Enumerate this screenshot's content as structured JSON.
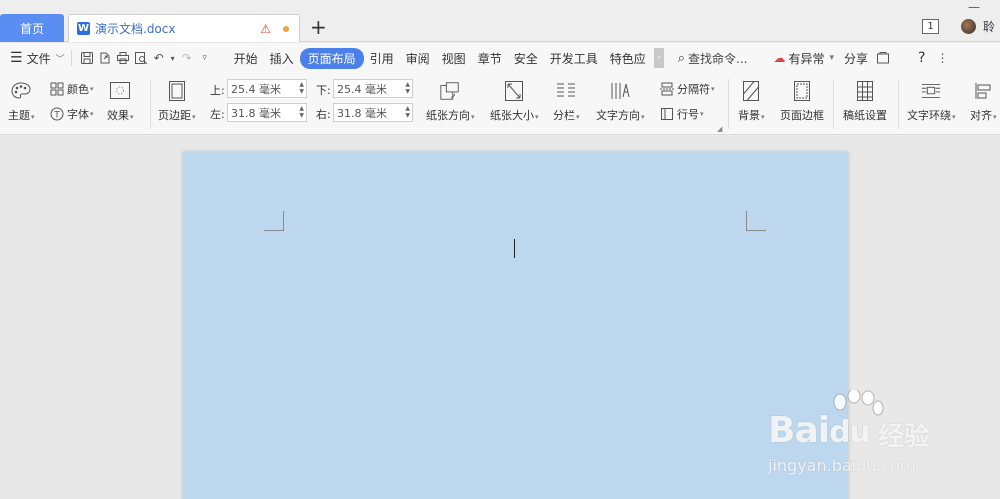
{
  "tabs": {
    "home": "首页",
    "doc_title": "演示文档.docx",
    "new_tab": "+"
  },
  "window": {
    "minimize": "—",
    "page_badge": "1",
    "user_name": "聆"
  },
  "menu": {
    "file": "文件",
    "tabs": [
      "开始",
      "插入",
      "页面布局",
      "引用",
      "审阅",
      "视图",
      "章节",
      "安全",
      "开发工具",
      "特色应"
    ],
    "active_tab": "页面布局",
    "search": "查找命令...",
    "anomaly": "有异常",
    "share": "分享",
    "help": "?"
  },
  "ribbon": {
    "theme": "主题",
    "color": "颜色",
    "font": "字体",
    "effect": "效果",
    "margins": "页边距",
    "top_label": "上:",
    "bottom_label": "下:",
    "left_label": "左:",
    "right_label": "右:",
    "top_value": "25.4 毫米",
    "bottom_value": "25.4 毫米",
    "left_value": "31.8 毫米",
    "right_value": "31.8 毫米",
    "orientation": "纸张方向",
    "size": "纸张大小",
    "columns": "分栏",
    "text_direction": "文字方向",
    "breaks": "分隔符",
    "line_numbers": "行号",
    "background": "背景",
    "page_border": "页面边框",
    "paper_setup": "稿纸设置",
    "text_wrap": "文字环绕",
    "align": "对齐"
  },
  "watermark": {
    "brand": "Bai",
    "brand_du": "du",
    "sub": "经验",
    "url": "jingyan.baidu.com"
  },
  "colors": {
    "accent": "#4a80e8",
    "home_tab": "#5b8ef3",
    "page_bg": "#bdd7ee"
  }
}
